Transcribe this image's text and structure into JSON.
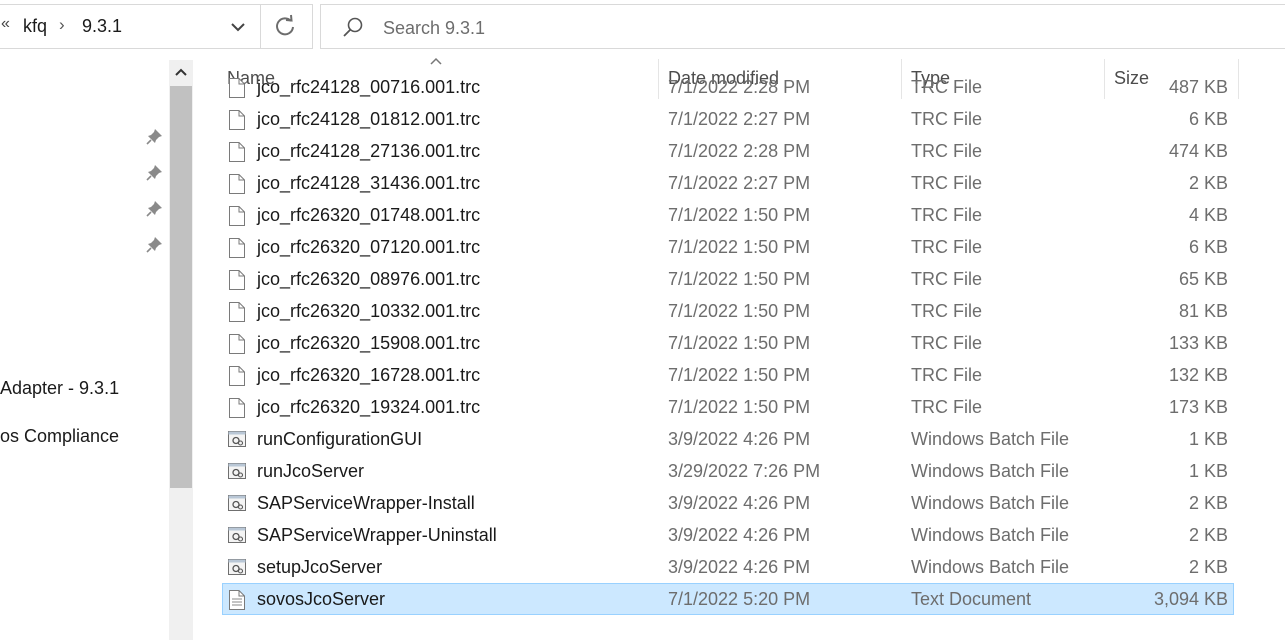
{
  "address": {
    "overflow_glyph": "«",
    "crumbs": [
      "kfq",
      "9.3.1"
    ],
    "separator": "›"
  },
  "search": {
    "placeholder": "Search 9.3.1"
  },
  "nav": {
    "labels": [
      "Adapter - 9.3.1",
      "os Compliance"
    ]
  },
  "columns": {
    "name": "Name",
    "date": "Date modified",
    "type": "Type",
    "size": "Size"
  },
  "files": [
    {
      "name": "jco_rfc24128_00716.001.trc",
      "date": "7/1/2022 2:28 PM",
      "type": "TRC File",
      "size": "487 KB",
      "icon": "file-icon"
    },
    {
      "name": "jco_rfc24128_01812.001.trc",
      "date": "7/1/2022 2:27 PM",
      "type": "TRC File",
      "size": "6 KB",
      "icon": "file-icon"
    },
    {
      "name": "jco_rfc24128_27136.001.trc",
      "date": "7/1/2022 2:28 PM",
      "type": "TRC File",
      "size": "474 KB",
      "icon": "file-icon"
    },
    {
      "name": "jco_rfc24128_31436.001.trc",
      "date": "7/1/2022 2:27 PM",
      "type": "TRC File",
      "size": "2 KB",
      "icon": "file-icon"
    },
    {
      "name": "jco_rfc26320_01748.001.trc",
      "date": "7/1/2022 1:50 PM",
      "type": "TRC File",
      "size": "4 KB",
      "icon": "file-icon"
    },
    {
      "name": "jco_rfc26320_07120.001.trc",
      "date": "7/1/2022 1:50 PM",
      "type": "TRC File",
      "size": "6 KB",
      "icon": "file-icon"
    },
    {
      "name": "jco_rfc26320_08976.001.trc",
      "date": "7/1/2022 1:50 PM",
      "type": "TRC File",
      "size": "65 KB",
      "icon": "file-icon"
    },
    {
      "name": "jco_rfc26320_10332.001.trc",
      "date": "7/1/2022 1:50 PM",
      "type": "TRC File",
      "size": "81 KB",
      "icon": "file-icon"
    },
    {
      "name": "jco_rfc26320_15908.001.trc",
      "date": "7/1/2022 1:50 PM",
      "type": "TRC File",
      "size": "133 KB",
      "icon": "file-icon"
    },
    {
      "name": "jco_rfc26320_16728.001.trc",
      "date": "7/1/2022 1:50 PM",
      "type": "TRC File",
      "size": "132 KB",
      "icon": "file-icon"
    },
    {
      "name": "jco_rfc26320_19324.001.trc",
      "date": "7/1/2022 1:50 PM",
      "type": "TRC File",
      "size": "173 KB",
      "icon": "file-icon"
    },
    {
      "name": "runConfigurationGUI",
      "date": "3/9/2022 4:26 PM",
      "type": "Windows Batch File",
      "size": "1 KB",
      "icon": "batch-file-icon"
    },
    {
      "name": "runJcoServer",
      "date": "3/29/2022 7:26 PM",
      "type": "Windows Batch File",
      "size": "1 KB",
      "icon": "batch-file-icon"
    },
    {
      "name": "SAPServiceWrapper-Install",
      "date": "3/9/2022 4:26 PM",
      "type": "Windows Batch File",
      "size": "2 KB",
      "icon": "batch-file-icon"
    },
    {
      "name": "SAPServiceWrapper-Uninstall",
      "date": "3/9/2022 4:26 PM",
      "type": "Windows Batch File",
      "size": "2 KB",
      "icon": "batch-file-icon"
    },
    {
      "name": "setupJcoServer",
      "date": "3/9/2022 4:26 PM",
      "type": "Windows Batch File",
      "size": "2 KB",
      "icon": "batch-file-icon"
    },
    {
      "name": "sovosJcoServer",
      "date": "7/1/2022 5:20 PM",
      "type": "Text Document",
      "size": "3,094 KB",
      "icon": "text-document-icon",
      "selected": true
    }
  ],
  "colors": {
    "selection_bg": "#cce8ff",
    "selection_border": "#99d1ff",
    "secondary_text": "#6d6d6d",
    "scrollbar_thumb": "#c1c1c1"
  }
}
